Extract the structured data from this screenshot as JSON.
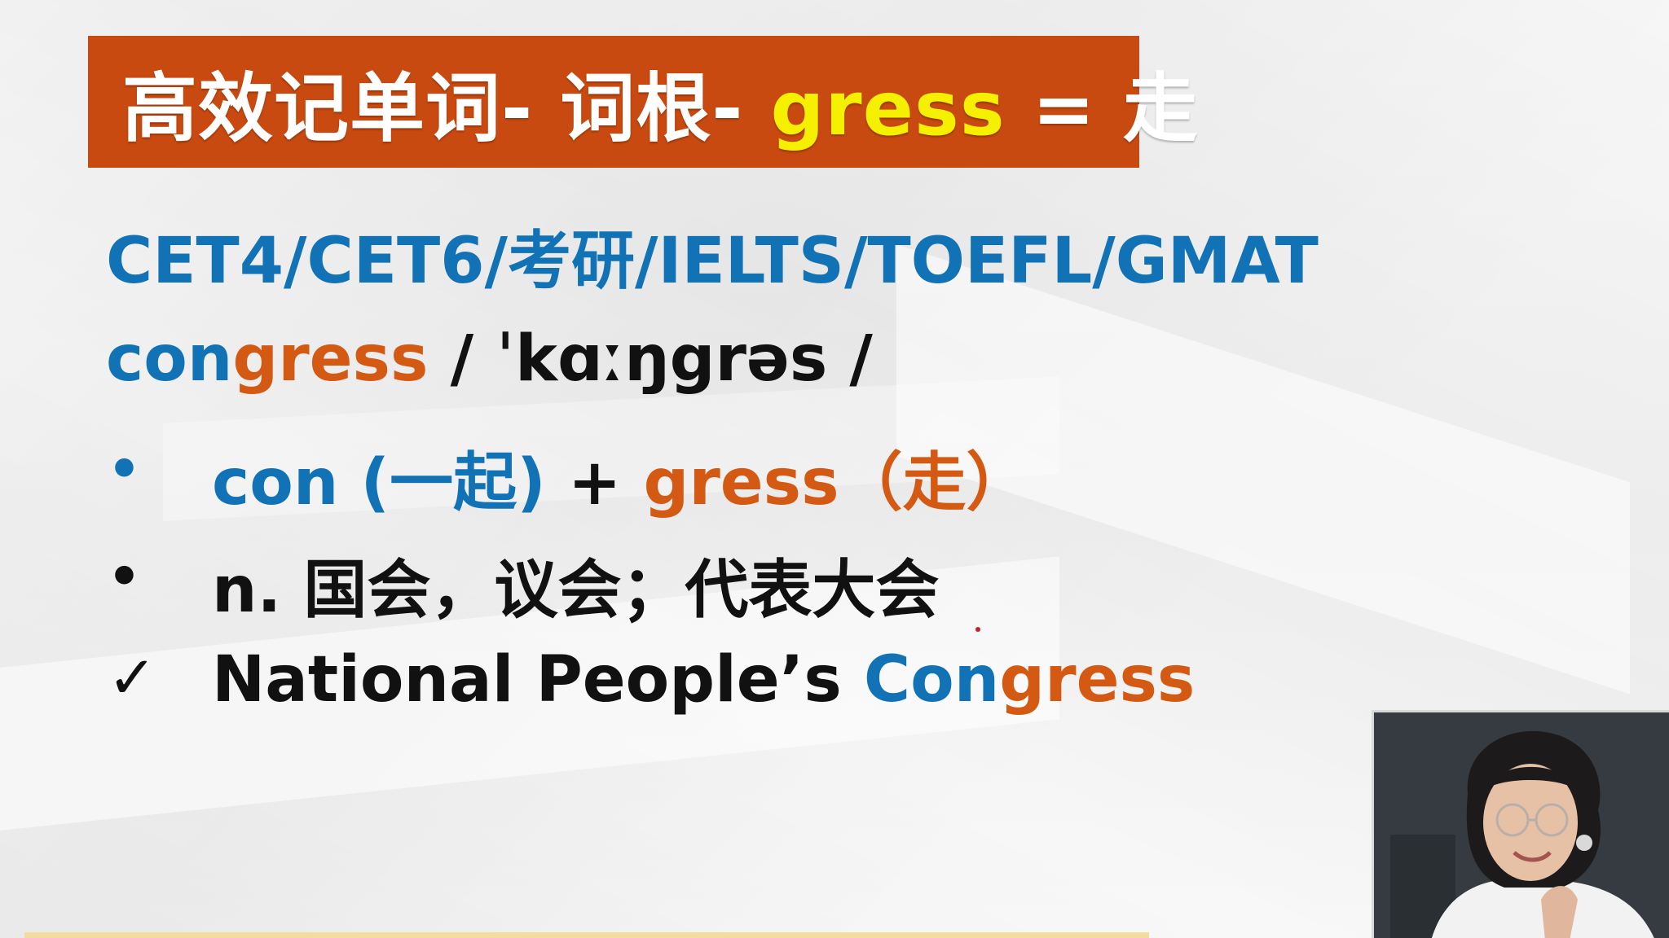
{
  "title": {
    "prefix": "高效记单词- 词根- ",
    "highlight": "gress",
    "suffix": " = 走"
  },
  "exams": "CET4/CET6/考研/IELTS/TOEFL/GMAT",
  "word": {
    "prefix": "con",
    "root": "gress",
    "phonetic": " / ˈkɑːŋgrəs /"
  },
  "bullets": [
    {
      "marker": "•",
      "parts": {
        "a": "con (一起) ",
        "plus": " + ",
        "b": "gress（走）"
      }
    },
    {
      "marker": "•",
      "text": "n. 国会，议会；代表大会"
    }
  ],
  "example": {
    "marker": "✓",
    "text_dark": "National People’s ",
    "text_blue": "Con",
    "text_orange": "gress"
  },
  "colors": {
    "title_bg": "#c94a10",
    "title_highlight": "#f5f000",
    "blue": "#1173b5",
    "orange": "#d45a14"
  }
}
